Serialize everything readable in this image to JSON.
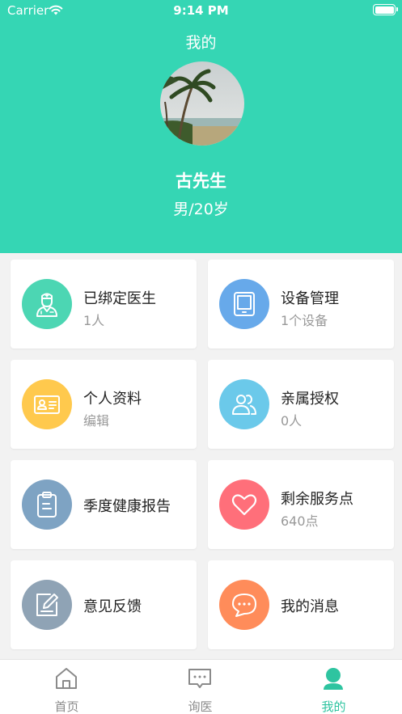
{
  "status_bar": {
    "carrier": "Carrier",
    "time": "9:14 PM"
  },
  "header": {
    "title": "我的",
    "user_name": "古先生",
    "user_info": "男/20岁"
  },
  "cards": [
    {
      "label": "已绑定医生",
      "sub": "1人",
      "icon": "doctor-icon",
      "color": "#4cd6b3"
    },
    {
      "label": "设备管理",
      "sub": "1个设备",
      "icon": "tablet-icon",
      "color": "#67a9ea"
    },
    {
      "label": "个人资料",
      "sub": "编辑",
      "icon": "id-card-icon",
      "color": "#ffc94d"
    },
    {
      "label": "亲属授权",
      "sub": "0人",
      "icon": "people-icon",
      "color": "#6bc9ea"
    },
    {
      "label": "季度健康报告",
      "sub": "",
      "icon": "clipboard-icon",
      "color": "#7ea3c3"
    },
    {
      "label": "剩余服务点",
      "sub": "640点",
      "icon": "heart-icon",
      "color": "#ff6f7a"
    },
    {
      "label": "意见反馈",
      "sub": "",
      "icon": "edit-icon",
      "color": "#8fa3b5"
    },
    {
      "label": "我的消息",
      "sub": "",
      "icon": "chat-icon",
      "color": "#ff8c5a"
    }
  ],
  "tabbar": {
    "items": [
      {
        "label": "首页",
        "icon": "home-icon",
        "active": false
      },
      {
        "label": "询医",
        "icon": "message-icon",
        "active": false
      },
      {
        "label": "我的",
        "icon": "profile-icon",
        "active": true
      }
    ],
    "active_color": "#2ec4a0"
  },
  "colors": {
    "accent": "#35d6b4"
  }
}
